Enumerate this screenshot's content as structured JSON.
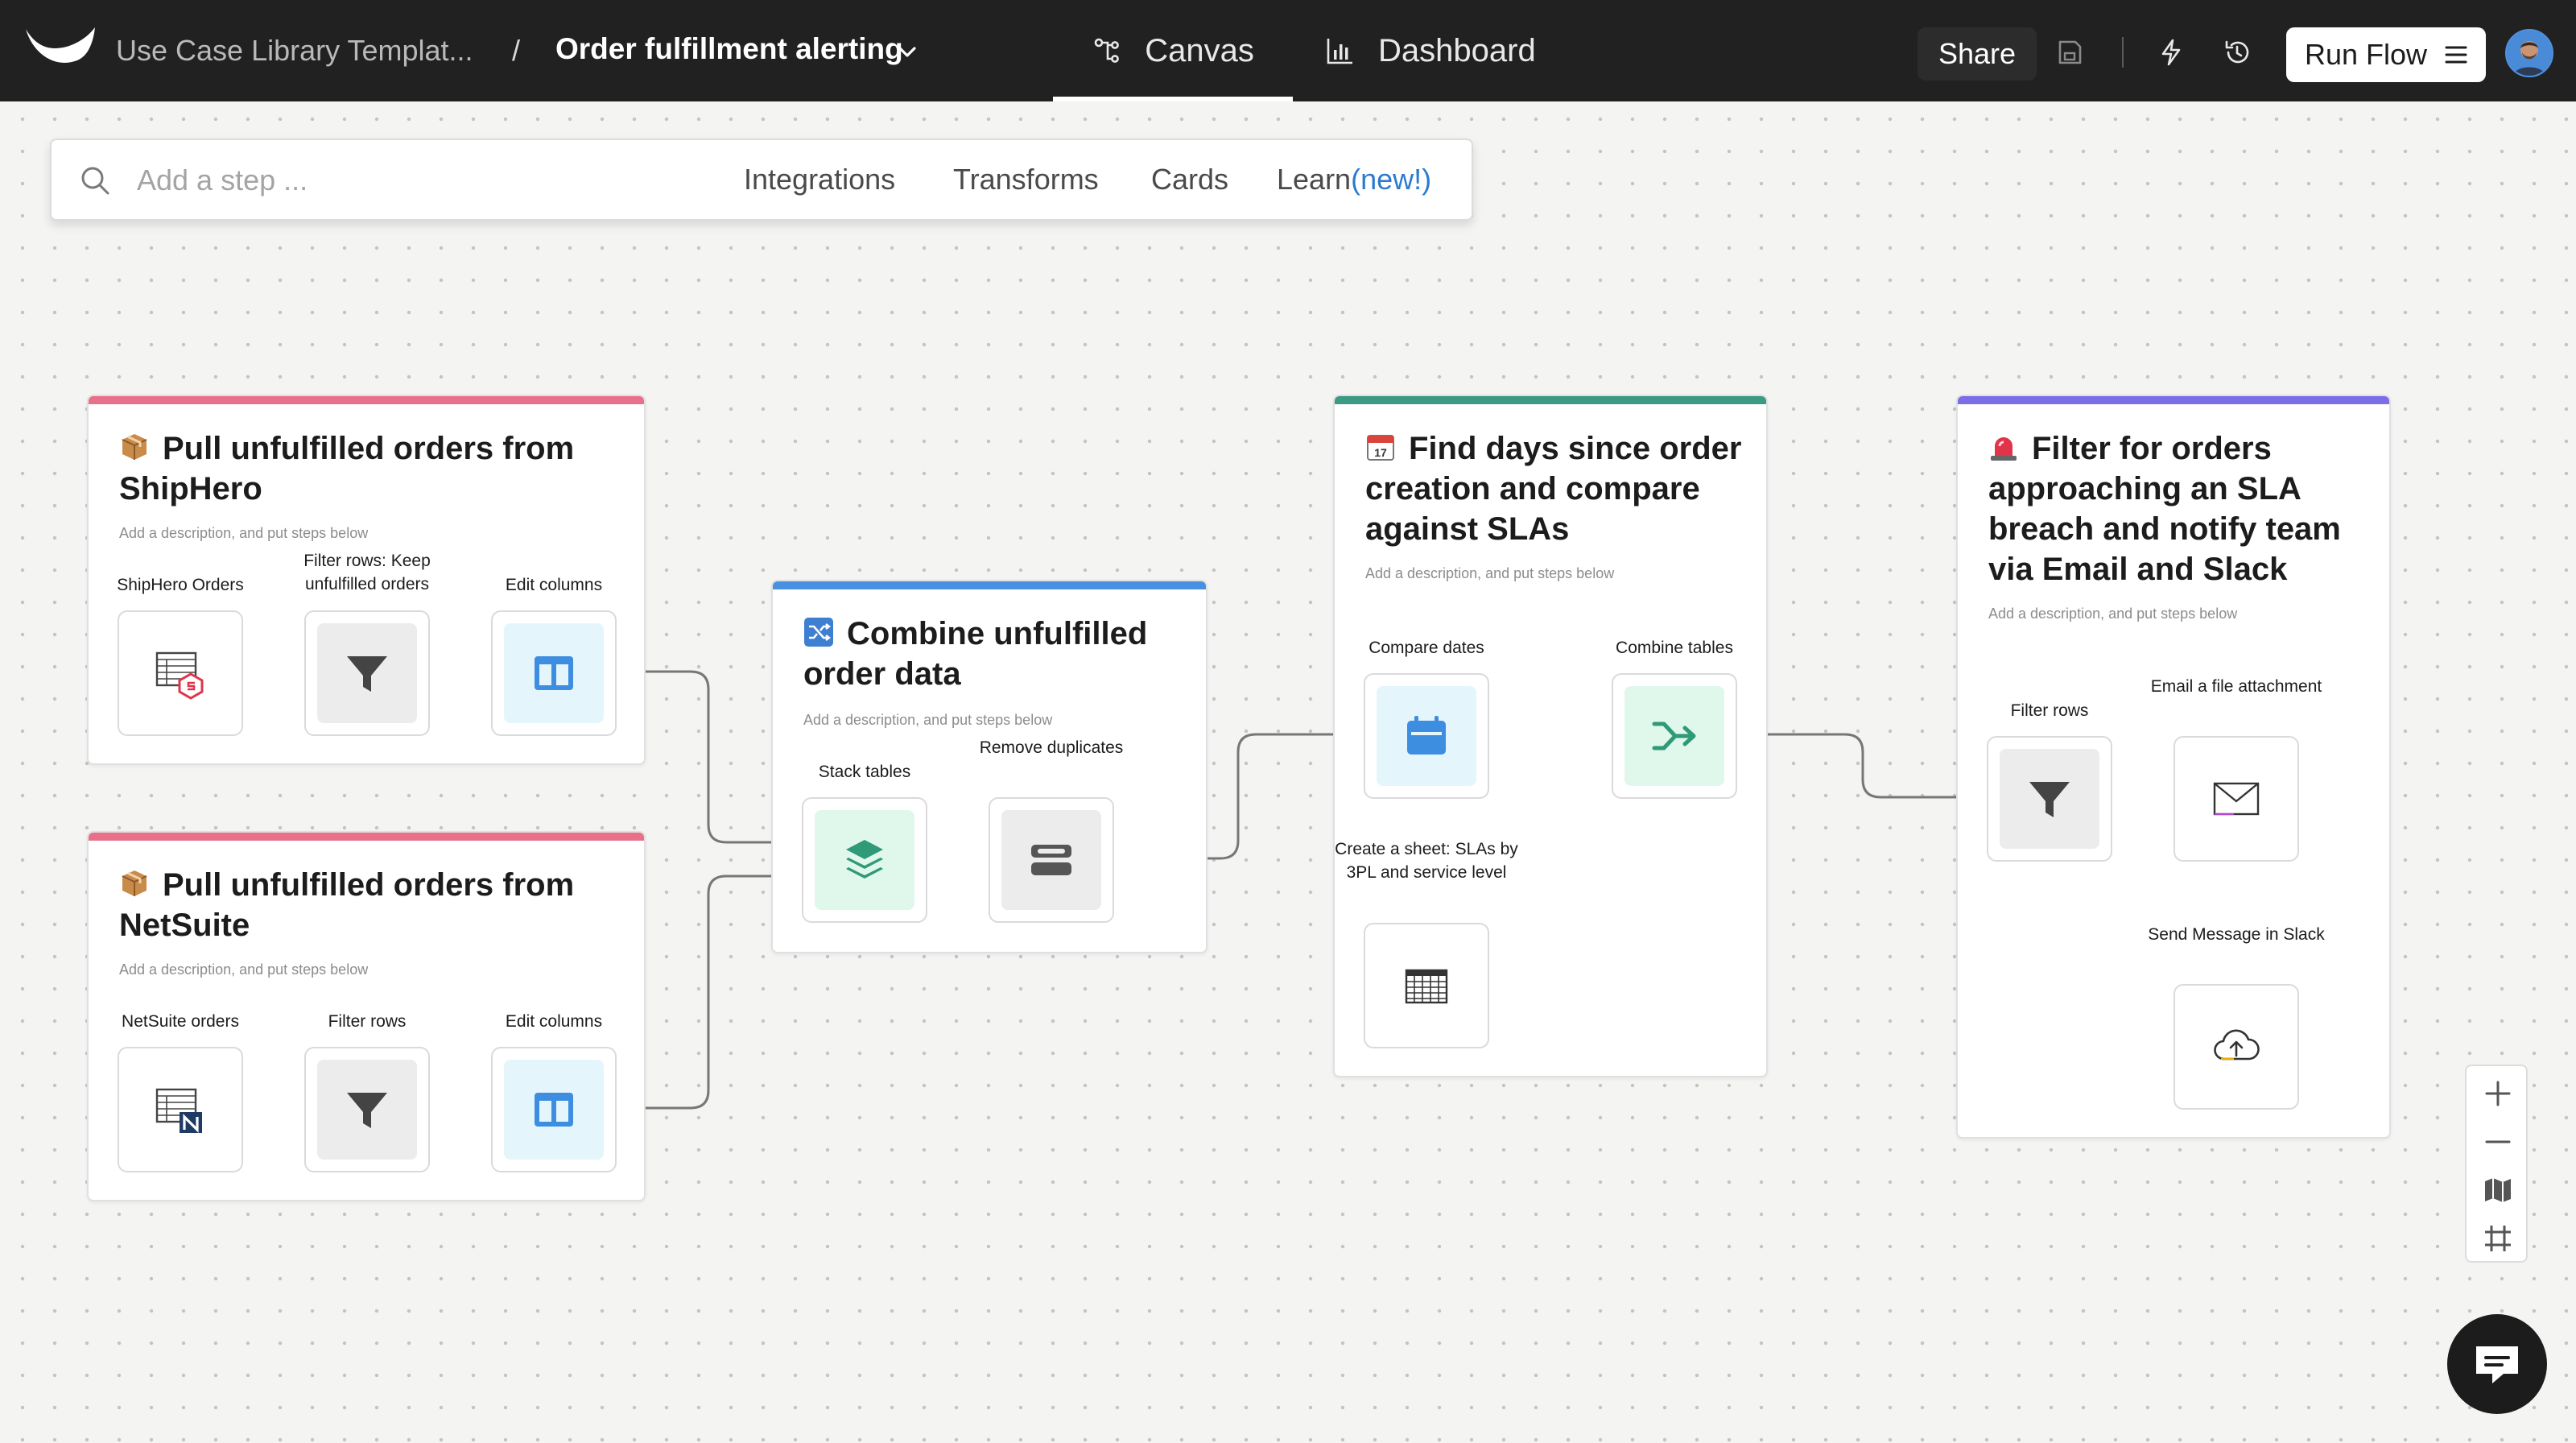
{
  "header": {
    "project": "Use Case Library Templat...",
    "separator": "/",
    "flow_name": "Order fulfillment alerting",
    "tabs": [
      {
        "label": "Canvas",
        "icon": "canvas-icon",
        "active": true
      },
      {
        "label": "Dashboard",
        "icon": "bar-chart-icon",
        "active": false
      }
    ],
    "share_label": "Share",
    "run_label": "Run Flow"
  },
  "search": {
    "placeholder": "Add a step ...",
    "links": [
      "Integrations",
      "Transforms",
      "Cards"
    ],
    "learn_label": "Learn",
    "learn_badge": "(new!)"
  },
  "cards": [
    {
      "title": "Pull unfulfilled orders from ShipHero",
      "emoji": "package-icon",
      "accent": "#e8708a",
      "description": "Add a description, and put steps below",
      "steps": [
        {
          "label": "ShipHero Orders",
          "icon": "shiphero-table-icon"
        },
        {
          "label": "Filter rows: Keep unfulfilled orders",
          "icon": "filter-icon"
        },
        {
          "label": "Edit columns",
          "icon": "columns-icon"
        }
      ]
    },
    {
      "title": "Pull unfulfilled orders from NetSuite",
      "emoji": "package-icon",
      "accent": "#e8708a",
      "description": "Add a description, and put steps below",
      "steps": [
        {
          "label": "NetSuite orders",
          "icon": "netsuite-table-icon"
        },
        {
          "label": "Filter rows",
          "icon": "filter-icon"
        },
        {
          "label": "Edit columns",
          "icon": "columns-icon"
        }
      ]
    },
    {
      "title": "Combine unfulfilled order data",
      "emoji": "shuffle-icon",
      "accent": "#4a90e2",
      "description": "Add a description, and put steps below",
      "steps": [
        {
          "label": "Stack tables",
          "icon": "layers-icon"
        },
        {
          "label": "Remove duplicates",
          "icon": "dedupe-icon"
        }
      ]
    },
    {
      "title": "Find days since order creation and compare against SLAs",
      "emoji": "calendar-emoji-icon",
      "accent": "#3a9a82",
      "description": "Add a description, and put steps below",
      "steps": [
        {
          "label": "Compare dates",
          "icon": "calendar-icon"
        },
        {
          "label": "Combine tables",
          "icon": "merge-icon"
        },
        {
          "label": "Create a sheet: SLAs by 3PL and service level",
          "icon": "sheet-icon"
        }
      ]
    },
    {
      "title": "Filter for orders approaching an SLA breach and notify team via Email and Slack",
      "emoji": "siren-icon",
      "accent": "#7b6ee6",
      "description": "Add a description, and put steps below",
      "steps": [
        {
          "label": "Filter rows",
          "icon": "filter-icon"
        },
        {
          "label": "Email a file attachment",
          "icon": "envelope-icon"
        },
        {
          "label": "Send Message in Slack",
          "icon": "cloud-upload-icon"
        }
      ]
    }
  ],
  "zoom_controls": [
    "zoom-in-icon",
    "zoom-out-icon",
    "map-icon",
    "fit-frame-icon"
  ],
  "colors": {
    "topbar": "#212121",
    "canvas": "#f4f4f3",
    "learn_new": "#2a7bd0"
  }
}
